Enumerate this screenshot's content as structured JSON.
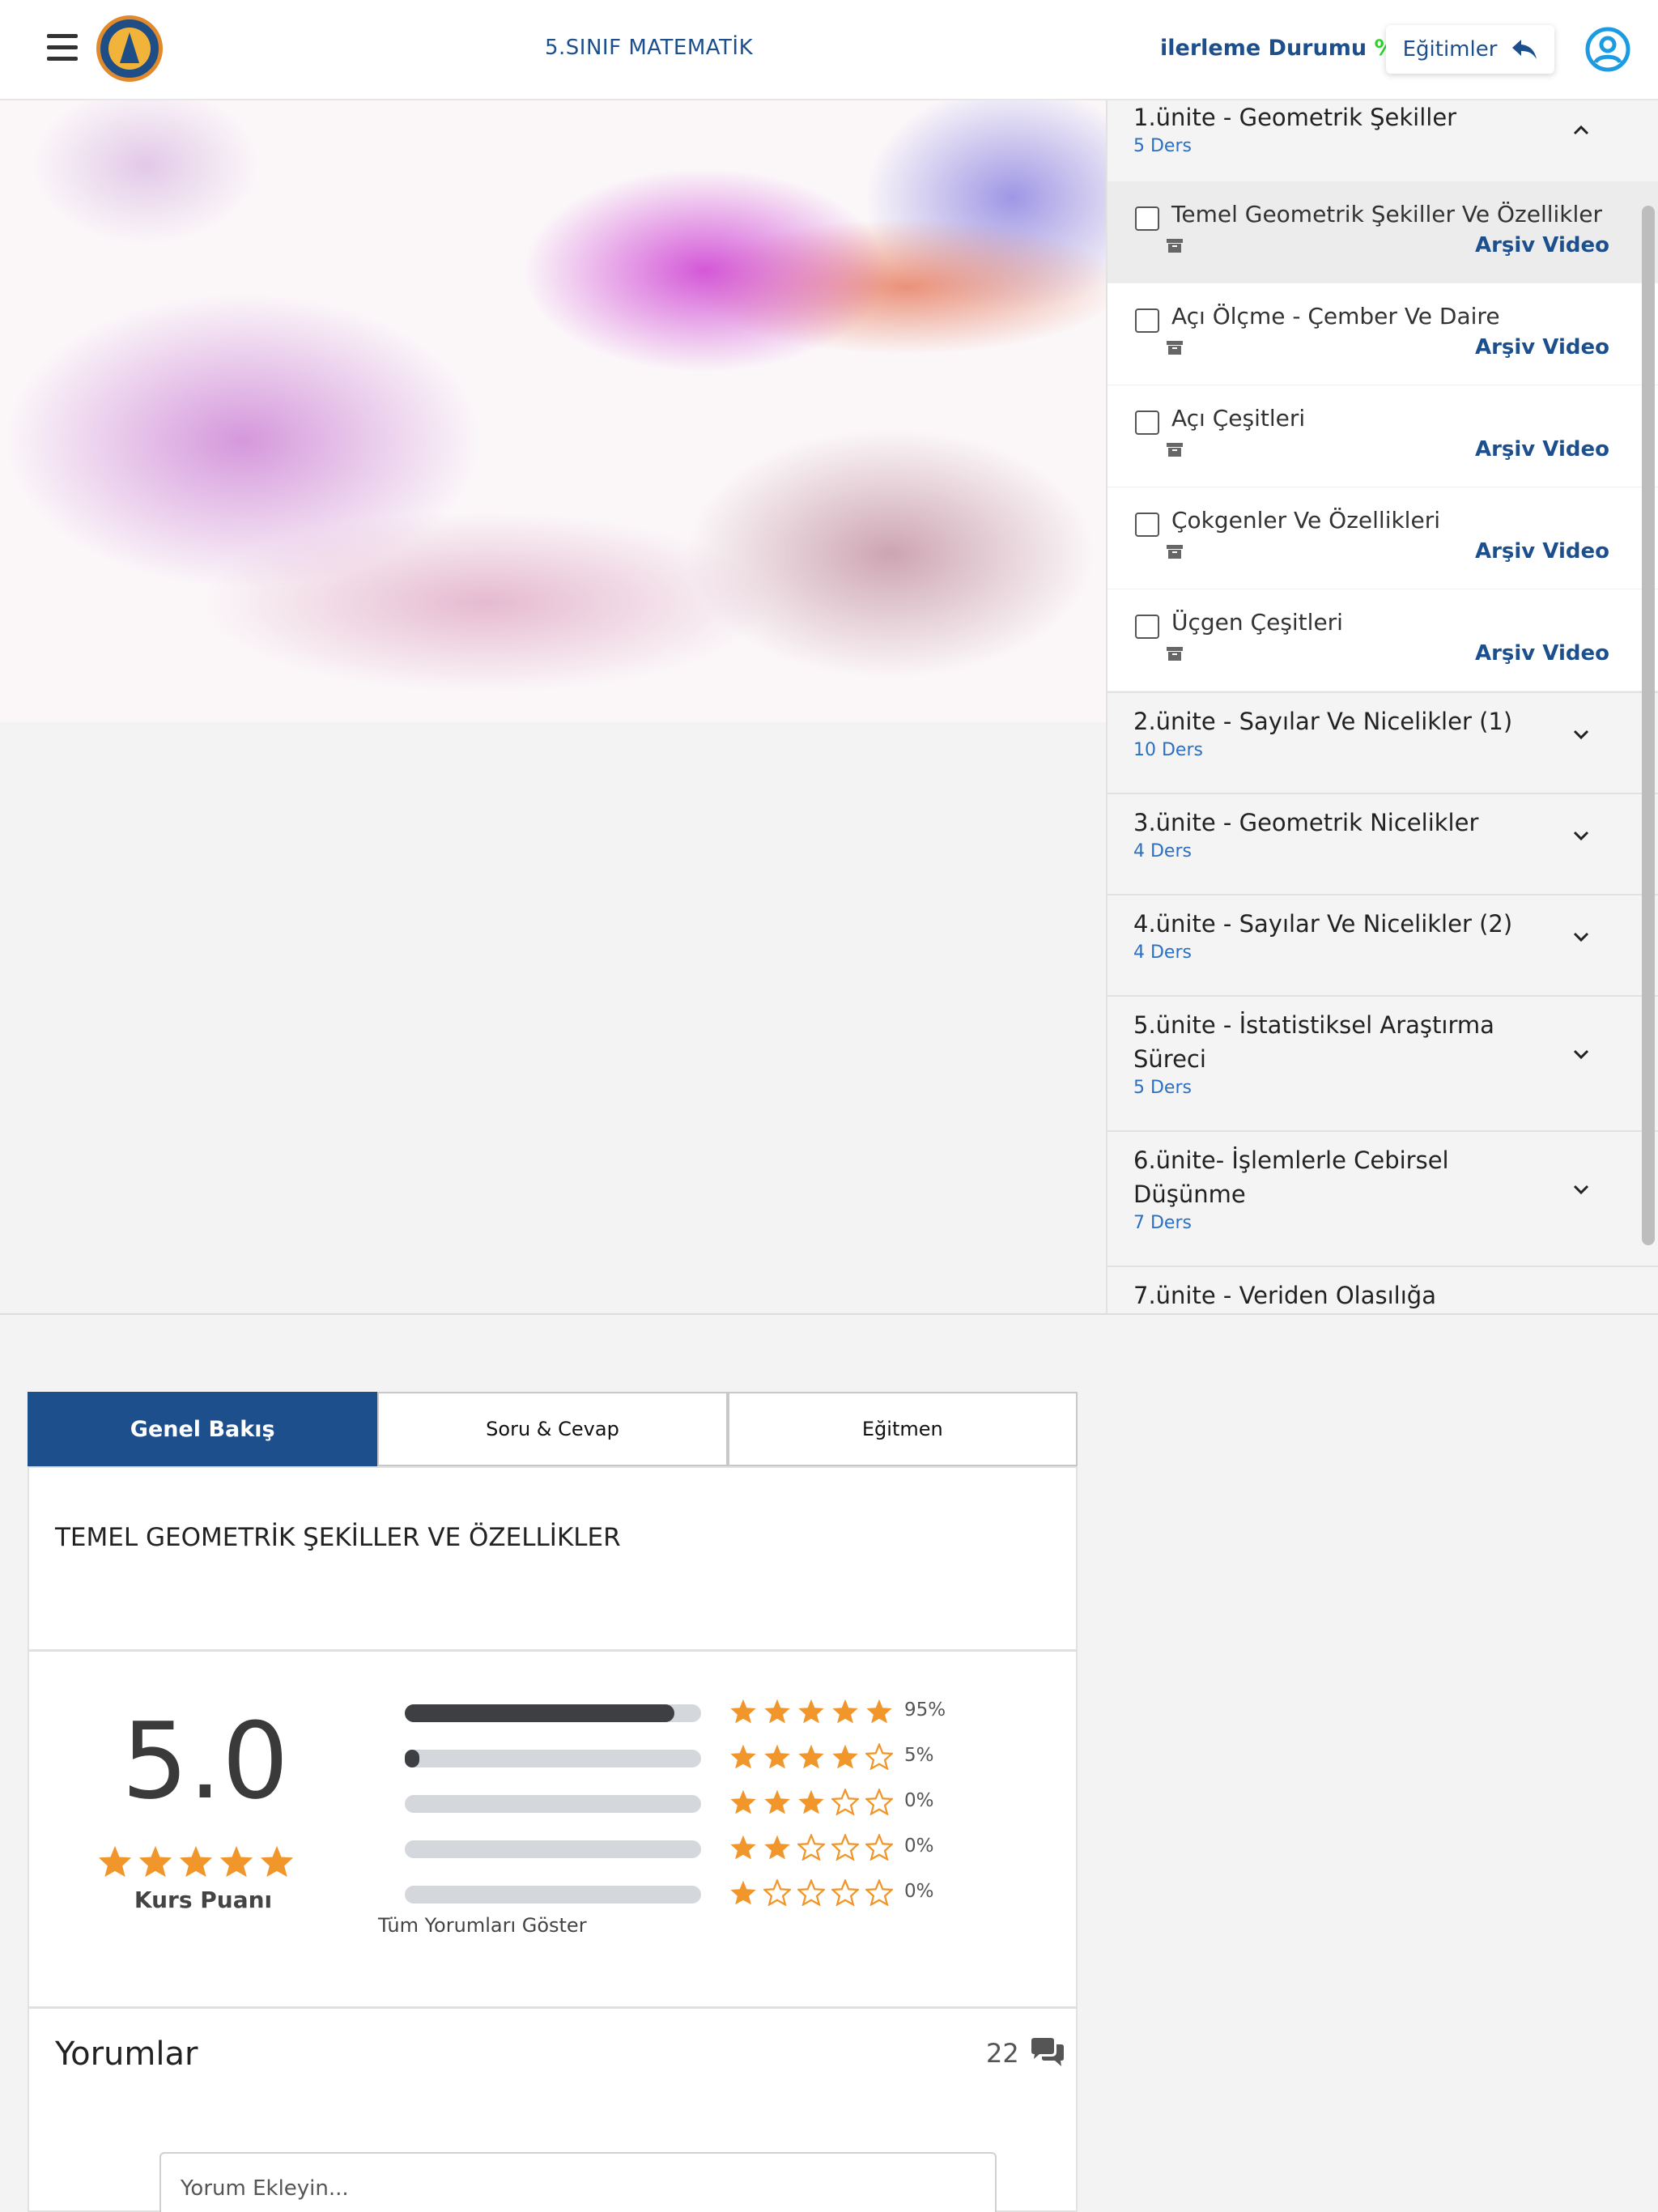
{
  "header": {
    "course_title": "5.SINIF MATEMATİK",
    "progress_label": "ilerleme Durumu",
    "progress_value": "%0",
    "back_button_label": "Eğitimler"
  },
  "units": [
    {
      "title": "1.ünite - Geometrik Şekiller",
      "count": "5 Ders",
      "expanded": true,
      "lessons": [
        {
          "title": "Temel Geometrik Şekiller Ve Özellikler",
          "tag": "Arşiv Video",
          "active": true
        },
        {
          "title": "Açı Ölçme - Çember Ve Daire",
          "tag": "Arşiv Video"
        },
        {
          "title": "Açı Çeşitleri",
          "tag": "Arşiv Video"
        },
        {
          "title": "Çokgenler Ve Özellikleri",
          "tag": "Arşiv Video"
        },
        {
          "title": "Üçgen Çeşitleri",
          "tag": "Arşiv Video"
        }
      ]
    },
    {
      "title": "2.ünite - Sayılar Ve Nicelikler (1)",
      "count": "10 Ders"
    },
    {
      "title": "3.ünite - Geometrik Nicelikler",
      "count": "4 Ders"
    },
    {
      "title": "4.ünite - Sayılar Ve Nicelikler (2)",
      "count": "4 Ders"
    },
    {
      "title": "5.ünite - İstatistiksel Araştırma Süreci",
      "count": "5 Ders"
    },
    {
      "title": "6.ünite- İşlemlerle Cebirsel Düşünme",
      "count": "7 Ders"
    },
    {
      "title": "7.ünite - Veriden Olasılığa",
      "count": ""
    }
  ],
  "tabs": [
    {
      "label": "Genel Bakış",
      "active": true
    },
    {
      "label": "Soru & Cevap"
    },
    {
      "label": "Eğitmen"
    }
  ],
  "overview": {
    "lesson_heading": "TEMEL GEOMETRİK ŞEKİLLER VE ÖZELLİKLER",
    "score": "5.0",
    "score_label": "Kurs Puanı",
    "show_all_label": "Tüm Yorumları Göster",
    "rating_rows": [
      {
        "stars": 5,
        "percent": "95%",
        "fill": 0.95
      },
      {
        "stars": 4,
        "percent": "5%",
        "fill": 0.05
      },
      {
        "stars": 3,
        "percent": "0%",
        "fill": 0
      },
      {
        "stars": 2,
        "percent": "0%",
        "fill": 0
      },
      {
        "stars": 1,
        "percent": "0%",
        "fill": 0
      }
    ]
  },
  "comments": {
    "title": "Yorumlar",
    "count": "22",
    "placeholder": "Yorum Ekleyin..."
  },
  "colors": {
    "brand_blue": "#1d4f8c",
    "link_blue": "#2c6fc0",
    "progress_green": "#2bd42b",
    "star_orange": "#f0962a"
  }
}
